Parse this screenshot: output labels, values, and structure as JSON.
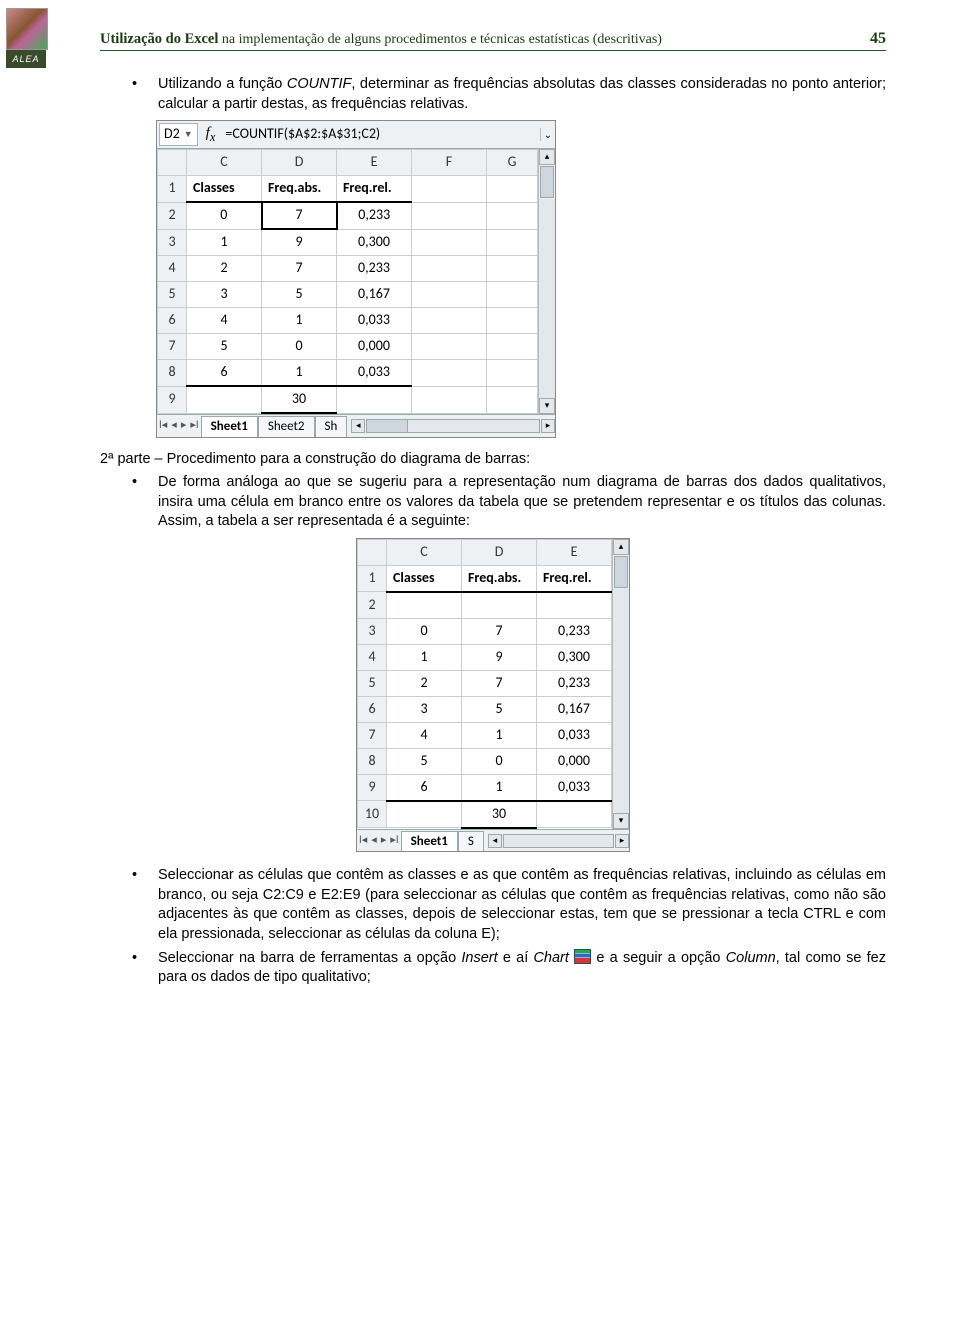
{
  "header": {
    "title_bold": "Utilização do Excel",
    "title_rest": " na implementação de alguns procedimentos e técnicas estatísticas (descritivas)",
    "page": "45"
  },
  "text": {
    "b1a": "Utilizando a função ",
    "b1b": "COUNTIF",
    "b1c": ", determinar as frequências absolutas das classes consideradas no ponto anterior; calcular a partir destas, as frequências relativas.",
    "p2": "2ª parte – Procedimento para a construção do diagrama de barras:",
    "b2": "De forma análoga ao que se sugeriu para a representação num diagrama de barras dos dados qualitativos, insira uma célula em branco entre os valores da tabela que se pretendem representar e os títulos das colunas. Assim, a tabela a ser representada é a seguinte:",
    "b3": "Seleccionar as células que contêm as classes e as que contêm as frequências relativas, incluindo as células em branco, ou seja C2:C9 e E2:E9 (para seleccionar as células que contêm as frequências relativas, como não são adjacentes às que contêm as classes, depois de seleccionar estas, tem que se pressionar a tecla CTRL e com ela pressionada, seleccionar as células da coluna E);",
    "b4a": "Seleccionar na barra de ferramentas a opção ",
    "b4b": "Insert",
    "b4c": " e aí ",
    "b4d": "Chart",
    "b4e": " e a seguir a opção ",
    "b4f": "Column",
    "b4g": ", tal como se fez para os dados de tipo qualitativo;"
  },
  "excel1": {
    "cellref": "D2",
    "formula": "=COUNTIF($A$2:$A$31;C2)",
    "cols": [
      "C",
      "D",
      "E",
      "F",
      "G"
    ],
    "headers": {
      "C": "Classes",
      "D": "Freq.abs.",
      "E": "Freq.rel."
    },
    "rows": [
      {
        "n": "1",
        "sel": false,
        "C": "Classes",
        "D": "Freq.abs.",
        "E": "Freq.rel.",
        "hdr": true
      },
      {
        "n": "2",
        "sel": true,
        "C": "0",
        "D": "7",
        "E": "0,233"
      },
      {
        "n": "3",
        "C": "1",
        "D": "9",
        "E": "0,300"
      },
      {
        "n": "4",
        "C": "2",
        "D": "7",
        "E": "0,233"
      },
      {
        "n": "5",
        "C": "3",
        "D": "5",
        "E": "0,167"
      },
      {
        "n": "6",
        "C": "4",
        "D": "1",
        "E": "0,033"
      },
      {
        "n": "7",
        "C": "5",
        "D": "0",
        "E": "0,000"
      },
      {
        "n": "8",
        "C": "6",
        "D": "1",
        "E": "0,033"
      },
      {
        "n": "9",
        "C": "",
        "D": "30",
        "E": ""
      }
    ],
    "tabs": [
      "Sheet1",
      "Sheet2",
      "Sh"
    ]
  },
  "excel2": {
    "cols": [
      "C",
      "D",
      "E"
    ],
    "rows": [
      {
        "n": "1",
        "C": "Classes",
        "D": "Freq.abs.",
        "E": "Freq.rel.",
        "hdr": true
      },
      {
        "n": "2",
        "C": "",
        "D": "",
        "E": ""
      },
      {
        "n": "3",
        "C": "0",
        "D": "7",
        "E": "0,233"
      },
      {
        "n": "4",
        "C": "1",
        "D": "9",
        "E": "0,300"
      },
      {
        "n": "5",
        "C": "2",
        "D": "7",
        "E": "0,233"
      },
      {
        "n": "6",
        "C": "3",
        "D": "5",
        "E": "0,167"
      },
      {
        "n": "7",
        "C": "4",
        "D": "1",
        "E": "0,033"
      },
      {
        "n": "8",
        "C": "5",
        "D": "0",
        "E": "0,000"
      },
      {
        "n": "9",
        "C": "6",
        "D": "1",
        "E": "0,033"
      },
      {
        "n": "10",
        "C": "",
        "D": "30",
        "E": ""
      }
    ],
    "tabs": [
      "Sheet1",
      "S"
    ]
  },
  "chart_data": [
    {
      "type": "table",
      "title": "Excel screenshot 1 – frequency table",
      "columns": [
        "Classes",
        "Freq.abs.",
        "Freq.rel."
      ],
      "rows": [
        [
          0,
          7,
          0.233
        ],
        [
          1,
          9,
          0.3
        ],
        [
          2,
          7,
          0.233
        ],
        [
          3,
          5,
          0.167
        ],
        [
          4,
          1,
          0.033
        ],
        [
          5,
          0,
          0.0
        ],
        [
          6,
          1,
          0.033
        ]
      ],
      "totals": {
        "Freq.abs.": 30
      }
    },
    {
      "type": "table",
      "title": "Excel screenshot 2 – table with blank row",
      "columns": [
        "Classes",
        "Freq.abs.",
        "Freq.rel."
      ],
      "rows": [
        [
          0,
          7,
          0.233
        ],
        [
          1,
          9,
          0.3
        ],
        [
          2,
          7,
          0.233
        ],
        [
          3,
          5,
          0.167
        ],
        [
          4,
          1,
          0.033
        ],
        [
          5,
          0,
          0.0
        ],
        [
          6,
          1,
          0.033
        ]
      ],
      "totals": {
        "Freq.abs.": 30
      }
    }
  ]
}
